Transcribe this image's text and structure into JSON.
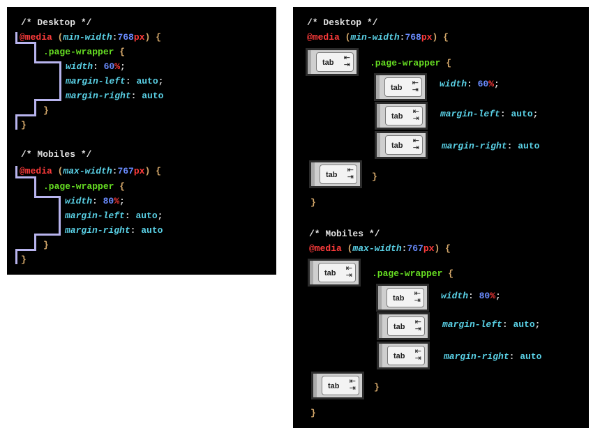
{
  "left": {
    "desktop": {
      "comment": "/* Desktop */",
      "at": "@media",
      "paren_open": " (",
      "feature": "min-width",
      "colon": ":",
      "num": "768",
      "unit": "px",
      "paren_close": ") {",
      "selector": ".page-wrapper",
      "sel_brace": " {",
      "decls": [
        {
          "prop": "width",
          "sep": ": ",
          "num": "60",
          "unit": "%",
          "end": ";"
        },
        {
          "prop": "margin-left",
          "sep": ": ",
          "val": "auto",
          "end": ";"
        },
        {
          "prop": "margin-right",
          "sep": ": ",
          "val": "auto",
          "end": ""
        }
      ],
      "close_inner": "}",
      "close_outer": "}"
    },
    "mobile": {
      "comment": "/* Mobiles */",
      "at": "@media",
      "paren_open": " (",
      "feature": "max-width",
      "colon": ":",
      "num": "767",
      "unit": "px",
      "paren_close": ") {",
      "selector": ".page-wrapper",
      "sel_brace": " {",
      "decls": [
        {
          "prop": "width",
          "sep": ": ",
          "num": "80",
          "unit": "%",
          "end": ";"
        },
        {
          "prop": "margin-left",
          "sep": ": ",
          "val": "auto",
          "end": ";"
        },
        {
          "prop": "margin-right",
          "sep": ": ",
          "val": "auto",
          "end": ""
        }
      ],
      "close_inner": "}",
      "close_outer": "}"
    }
  },
  "tab_key": {
    "label": "tab",
    "arrows_top": "⇤",
    "arrows_bottom": "⇥",
    "icon": "tab-key-icon"
  },
  "colors": {
    "background": "#000000",
    "comment": "#e0e0e0",
    "at_rule": "#ff3b3b",
    "property": "#5ad1e6",
    "number": "#6a8cff",
    "selector": "#66dd22",
    "brace": "#d6a96b",
    "guide": "#b8b4ee"
  }
}
